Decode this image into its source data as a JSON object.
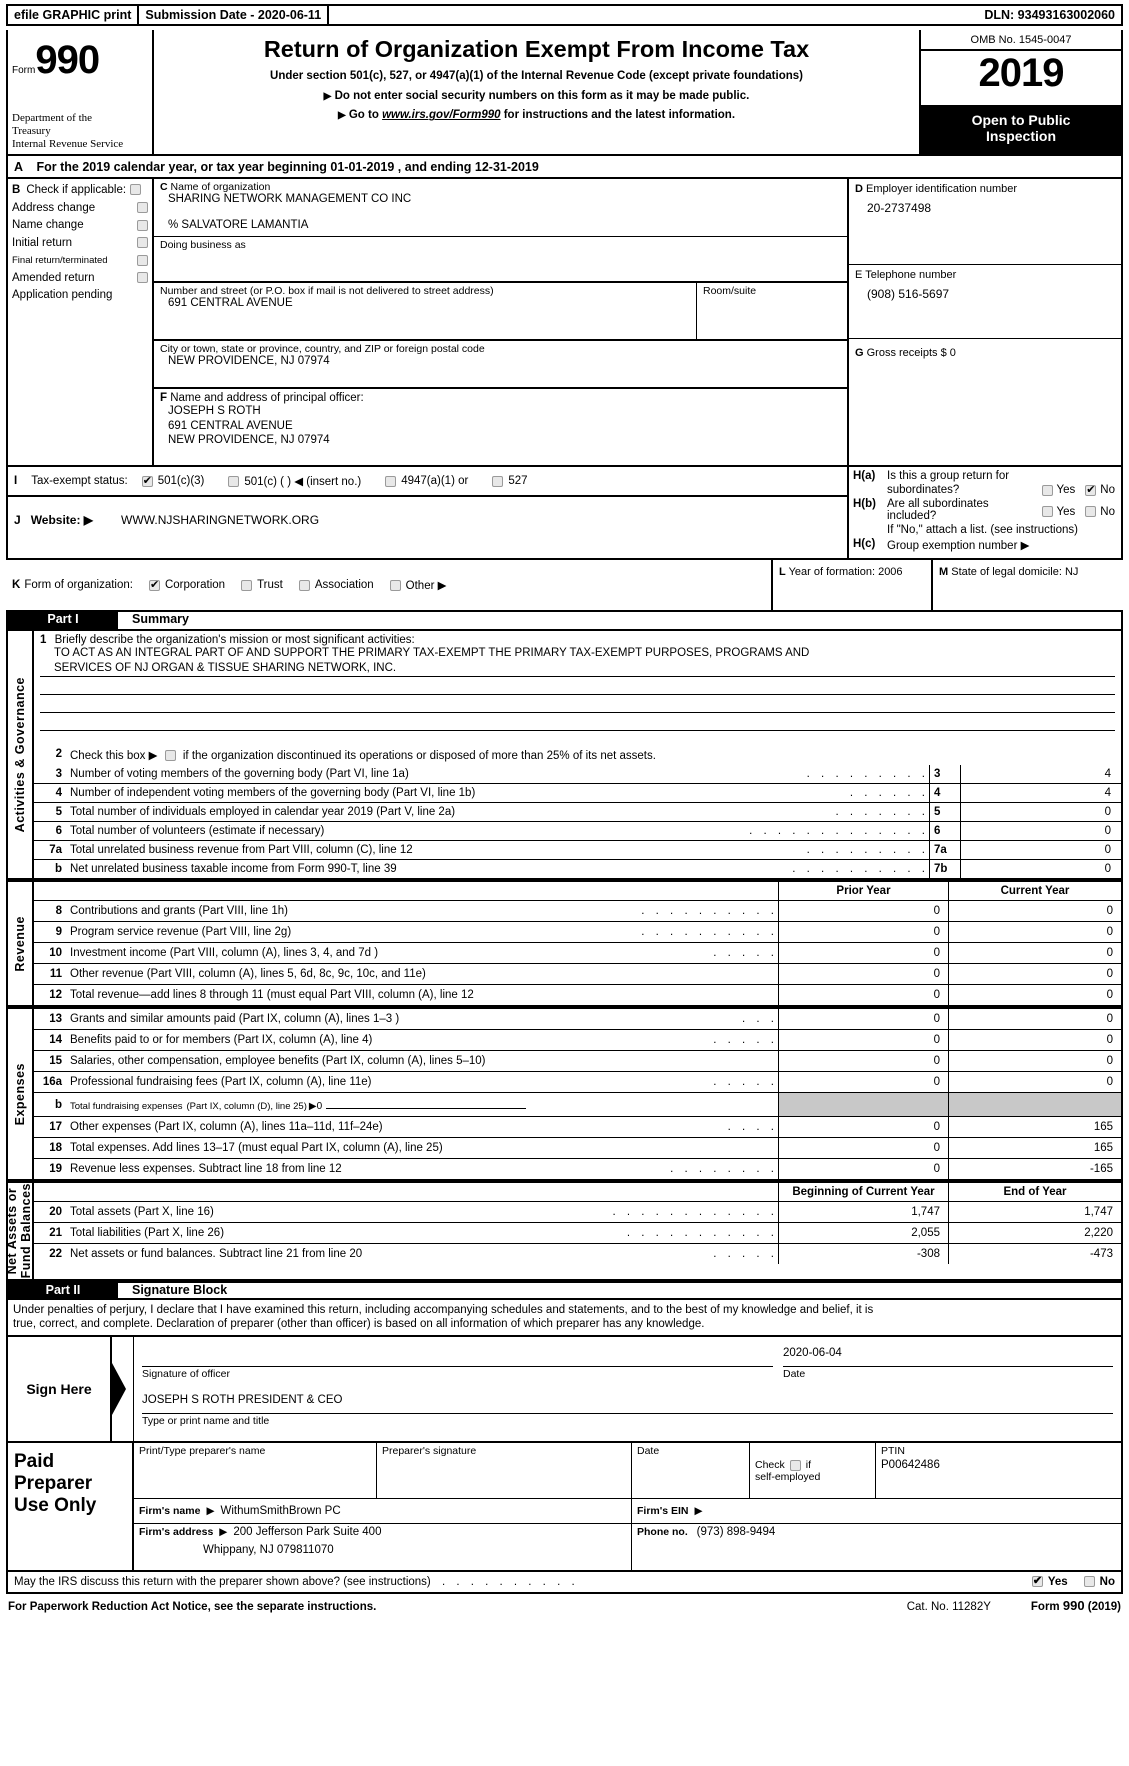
{
  "efile": {
    "graphic_print": "efile GRAPHIC print",
    "submission_date": "Submission Date - 2020-06-11",
    "dln": "DLN: 93493163002060"
  },
  "header": {
    "form_label": "Form",
    "form_number": "990",
    "department": "Department of the\nTreasury\nInternal Revenue Service",
    "dept_line1": "Department of the",
    "dept_line2": "Treasury",
    "dept_line3": "Internal Revenue Service",
    "title": "Return of Organization Exempt From Income Tax",
    "subtitle": "Under section 501(c), 527, or 4947(a)(1) of the Internal Revenue Code (except private foundations)",
    "bullet1": "Do not enter social security numbers on this form as it may be made public.",
    "bullet2_pre": "Go to ",
    "bullet2_link": "www.irs.gov/Form990",
    "bullet2_post": " for instructions and the latest information.",
    "omb": "OMB No. 1545-0047",
    "year": "2019",
    "open_to_public": "Open to Public\nInspection",
    "open_line1": "Open to Public",
    "open_line2": "Inspection"
  },
  "line_a": {
    "letter": "A",
    "text": "For the 2019 calendar year, or tax year beginning 01-01-2019          , and ending 12-31-2019"
  },
  "section_b": {
    "letter": "B",
    "heading": "Check if applicable:",
    "items": [
      {
        "label": "Address change",
        "checked": false
      },
      {
        "label": "Name change",
        "checked": false
      },
      {
        "label": "Initial return",
        "checked": false
      },
      {
        "label": "Final return/terminated",
        "checked": false,
        "small": true
      },
      {
        "label": "Amended return",
        "checked": false
      },
      {
        "label": "Application pending",
        "checked": false
      }
    ]
  },
  "section_c": {
    "letter": "C",
    "name_label": "Name of organization",
    "org_name": "SHARING NETWORK MANAGEMENT CO INC",
    "care_of": "% SALVATORE LAMANTIA",
    "dba_label": "Doing business as",
    "dba_value": "",
    "street_label": "Number and street (or P.O. box if mail is not delivered to street address)",
    "street_value": "691 CENTRAL AVENUE",
    "room_label": "Room/suite",
    "room_value": "",
    "city_label": "City or town, state or province, country, and ZIP or foreign postal code",
    "city_value": "NEW PROVIDENCE, NJ   07974"
  },
  "section_f": {
    "letter": "F",
    "label": "Name and address of principal officer:",
    "lines": [
      "JOSEPH S ROTH",
      "691 CENTRAL AVENUE",
      "NEW PROVIDENCE, NJ   07974"
    ]
  },
  "section_d": {
    "letter": "D",
    "label": "Employer identification number",
    "value": "20-2737498"
  },
  "section_e": {
    "letter": "E",
    "label": "Telephone number",
    "value": "(908) 516-5697"
  },
  "section_g": {
    "letter": "G",
    "label": "Gross receipts $ 0"
  },
  "section_h": {
    "ha_tag": "H(a)",
    "ha_line1": "Is this a group return for",
    "ha_line2": "subordinates?",
    "ha_yes": "Yes",
    "ha_no": "No",
    "ha_yes_checked": false,
    "ha_no_checked": true,
    "hb_tag": "H(b)",
    "hb_line1": "Are all subordinates",
    "hb_line2": "included?",
    "hb_yes": "Yes",
    "hb_no": "No",
    "hb_yes_checked": false,
    "hb_no_checked": false,
    "hb_note": "If \"No,\" attach a list. (see instructions)",
    "hc_tag": "H(c)",
    "hc_label": "Group exemption number ▶"
  },
  "section_i": {
    "letter": "I",
    "label": "Tax-exempt status:",
    "options": [
      {
        "label": "501(c)(3)",
        "checked": true
      },
      {
        "label": "501(c) (  ) ◀ (insert no.)",
        "checked": false
      },
      {
        "label": "4947(a)(1) or",
        "checked": false
      },
      {
        "label": "527",
        "checked": false
      }
    ]
  },
  "section_j": {
    "letter": "J",
    "label": "Website: ▶",
    "value": "WWW.NJSHARINGNETWORK.ORG"
  },
  "section_k": {
    "letter": "K",
    "label": "Form of organization:",
    "options": [
      {
        "label": "Corporation",
        "checked": true
      },
      {
        "label": "Trust",
        "checked": false
      },
      {
        "label": "Association",
        "checked": false
      },
      {
        "label": "Other ▶",
        "checked": false
      }
    ]
  },
  "section_l": {
    "letter": "L",
    "label": "Year of formation: 2006"
  },
  "section_m": {
    "letter": "M",
    "label": "State of legal domicile: NJ"
  },
  "part1": {
    "tag": "Part I",
    "title": "Summary",
    "vtab_gov": "Activities & Governance",
    "vtab_rev": "Revenue",
    "vtab_exp": "Expenses",
    "vtab_net": "Net Assets or\nFund Balances",
    "vtab_net_line1": "Net Assets or",
    "vtab_net_line2": "Fund Balances",
    "line1_num": "1",
    "line1_label": "Briefly describe the organization's mission or most significant activities:",
    "mission_line1": "TO ACT AS AN INTEGRAL PART OF AND SUPPORT THE PRIMARY TAX-EXEMPT THE PRIMARY TAX-EXEMPT PURPOSES, PROGRAMS AND",
    "mission_line2": "SERVICES OF NJ ORGAN & TISSUE SHARING NETWORK, INC.",
    "line2_num": "2",
    "line2_pre": "Check this box ▶",
    "line2_post": "if the organization discontinued its operations or disposed of more than 25% of its net assets.",
    "line2_checked": false,
    "gov_rows": [
      {
        "num": "3",
        "label": "Number of voting members of the governing body (Part VI, line 1a)",
        "dots": ".    .    .    .    .    .    .    .    .",
        "key": "3",
        "value": "4"
      },
      {
        "num": "4",
        "label": "Number of independent voting members of the governing body (Part VI, line 1b)",
        "dots": ".    .    .    .    .    .",
        "key": "4",
        "value": "4"
      },
      {
        "num": "5",
        "label": "Total number of individuals employed in calendar year 2019 (Part V, line 2a)",
        "dots": ".    .    .    .    .    .    .",
        "key": "5",
        "value": "0"
      },
      {
        "num": "6",
        "label": "Total number of volunteers (estimate if necessary)",
        "dots": ".    .    .    .    .    .    .    .    .    .    .    .    .",
        "key": "6",
        "value": "0"
      },
      {
        "num": "7a",
        "label": "Total unrelated business revenue from Part VIII, column (C), line 12",
        "dots": ".    .    .    .    .    .    .    .    .",
        "key": "7a",
        "value": "0"
      },
      {
        "num": "b",
        "label": "Net unrelated business taxable income from Form 990-T, line 39",
        "dots": ".    .    .    .    .    .    .    .    .    .",
        "key": "7b",
        "value": "0"
      }
    ],
    "col_prior": "Prior Year",
    "col_current": "Current Year",
    "revenue_rows": [
      {
        "num": "8",
        "label": "Contributions and grants (Part VIII, line 1h)",
        "dots": ".    .    .    .    .    .    .    .    .    .",
        "prior": "0",
        "current": "0"
      },
      {
        "num": "9",
        "label": "Program service revenue (Part VIII, line 2g)",
        "dots": ".    .    .    .    .    .    .    .    .    .",
        "prior": "0",
        "current": "0"
      },
      {
        "num": "10",
        "label": "Investment income (Part VIII, column (A), lines 3, 4, and 7d )",
        "dots": ".    .    .    .    .",
        "prior": "0",
        "current": "0"
      },
      {
        "num": "11",
        "label": "Other revenue (Part VIII, column (A), lines 5, 6d, 8c, 9c, 10c, and 11e)",
        "dots": "",
        "prior": "0",
        "current": "0"
      },
      {
        "num": "12",
        "label": "Total revenue—add lines 8 through 11 (must equal Part VIII, column (A), line 12",
        "dots": "",
        "prior": "0",
        "current": "0"
      }
    ],
    "expense_rows": [
      {
        "num": "13",
        "label": "Grants and similar amounts paid (Part IX, column (A), lines 1–3 )",
        "dots": ".    .    .",
        "prior": "0",
        "current": "0"
      },
      {
        "num": "14",
        "label": "Benefits paid to or for members (Part IX, column (A), line 4)",
        "dots": ".    .    .    .    .",
        "prior": "0",
        "current": "0"
      },
      {
        "num": "15",
        "label": "Salaries, other compensation, employee benefits (Part IX, column (A), lines 5–10)",
        "dots": "",
        "prior": "0",
        "current": "0"
      },
      {
        "num": "16a",
        "label": "Professional fundraising fees (Part IX, column (A), line 11e)",
        "dots": ".    .    .    .    .",
        "prior": "0",
        "current": "0"
      }
    ],
    "expense_16b": {
      "num": "b",
      "label_small": "Total fundraising expenses",
      "label_mid": "(Part IX, column (D), line 25)",
      "arrow_value": "▶0",
      "shaded": true
    },
    "expense_rows2": [
      {
        "num": "17",
        "label": "Other expenses (Part IX, column (A), lines 11a–11d, 11f–24e)",
        "dots": ".    .    .    .",
        "prior": "0",
        "current": "165"
      },
      {
        "num": "18",
        "label": "Total expenses. Add lines 13–17 (must equal Part IX, column (A), line 25)",
        "dots": "",
        "prior": "0",
        "current": "165"
      },
      {
        "num": "19",
        "label": "Revenue less expenses. Subtract line 18 from line 12",
        "dots": ".    .    .    .    .    .    .    .",
        "prior": "0",
        "current": "-165"
      }
    ],
    "col_begin": "Beginning of Current Year",
    "col_end": "End of Year",
    "net_rows": [
      {
        "num": "20",
        "label": "Total assets (Part X, line 16)",
        "dots": ".    .    .    .    .    .    .    .    .    .    .    .",
        "prior": "1,747",
        "current": "1,747"
      },
      {
        "num": "21",
        "label": "Total liabilities (Part X, line 26)",
        "dots": ".    .    .    .    .    .    .    .    .    .    .",
        "prior": "2,055",
        "current": "2,220"
      },
      {
        "num": "22",
        "label": "Net assets or fund balances. Subtract line 21 from line 20",
        "dots": ".    .    .    .    .",
        "prior": "-308",
        "current": "-473"
      }
    ]
  },
  "part2": {
    "tag": "Part II",
    "title": "Signature Block",
    "perjury_line1": "Under penalties of perjury, I declare that I have examined this return, including accompanying schedules and statements, and to the best of my knowledge and belief, it is",
    "perjury_line2": "true, correct, and complete. Declaration of preparer (other than officer) is based on all information of which preparer has any knowledge.",
    "sign_here": "Sign Here",
    "signature_value": "",
    "signature_caption": "Signature of officer",
    "date_value": "2020-06-04",
    "date_caption": "Date",
    "name_title_value": "JOSEPH S ROTH  PRESIDENT & CEO",
    "name_title_caption": "Type or print name and title"
  },
  "preparer": {
    "left_line1": "Paid",
    "left_line2": "Preparer",
    "left_line3": "Use Only",
    "hdr_print_name": "Print/Type preparer's name",
    "hdr_signature": "Preparer's signature",
    "hdr_date": "Date",
    "hdr_check": "Check",
    "hdr_check_if": "if",
    "hdr_self_employed": "self-employed",
    "hdr_ptin": "PTIN",
    "ptin_value": "P00642486",
    "check_checked": false,
    "print_name_value": "",
    "signature_value": "",
    "date_value": "",
    "firm_name_label": "Firm's name",
    "firm_name_arrow": "▶",
    "firm_name_value": "WithumSmithBrown PC",
    "firm_ein_label": "Firm's EIN",
    "firm_ein_arrow": "▶",
    "firm_ein_value": "",
    "firm_address_label": "Firm's address",
    "firm_address_arrow": "▶",
    "firm_address_value": "200 Jefferson Park Suite 400",
    "firm_address_value2": "Whippany, NJ   079811070",
    "phone_label": "Phone no.",
    "phone_value": "(973) 898-9494"
  },
  "footer": {
    "discuss_question": "May the IRS discuss this return with the preparer shown above? (see instructions)",
    "discuss_dots": ".    .    .    .    .    .    .    .    .    .",
    "yes_label": "Yes",
    "no_label": "No",
    "yes_checked": true,
    "no_checked": false,
    "paperwork": "For Paperwork Reduction Act Notice, see the separate instructions.",
    "cat_no": "Cat. No. 11282Y",
    "form_ref": "Form 990 (2019)",
    "form_ref_bold": "990",
    "form_ref_pre": "Form ",
    "form_ref_post": " (2019)"
  }
}
